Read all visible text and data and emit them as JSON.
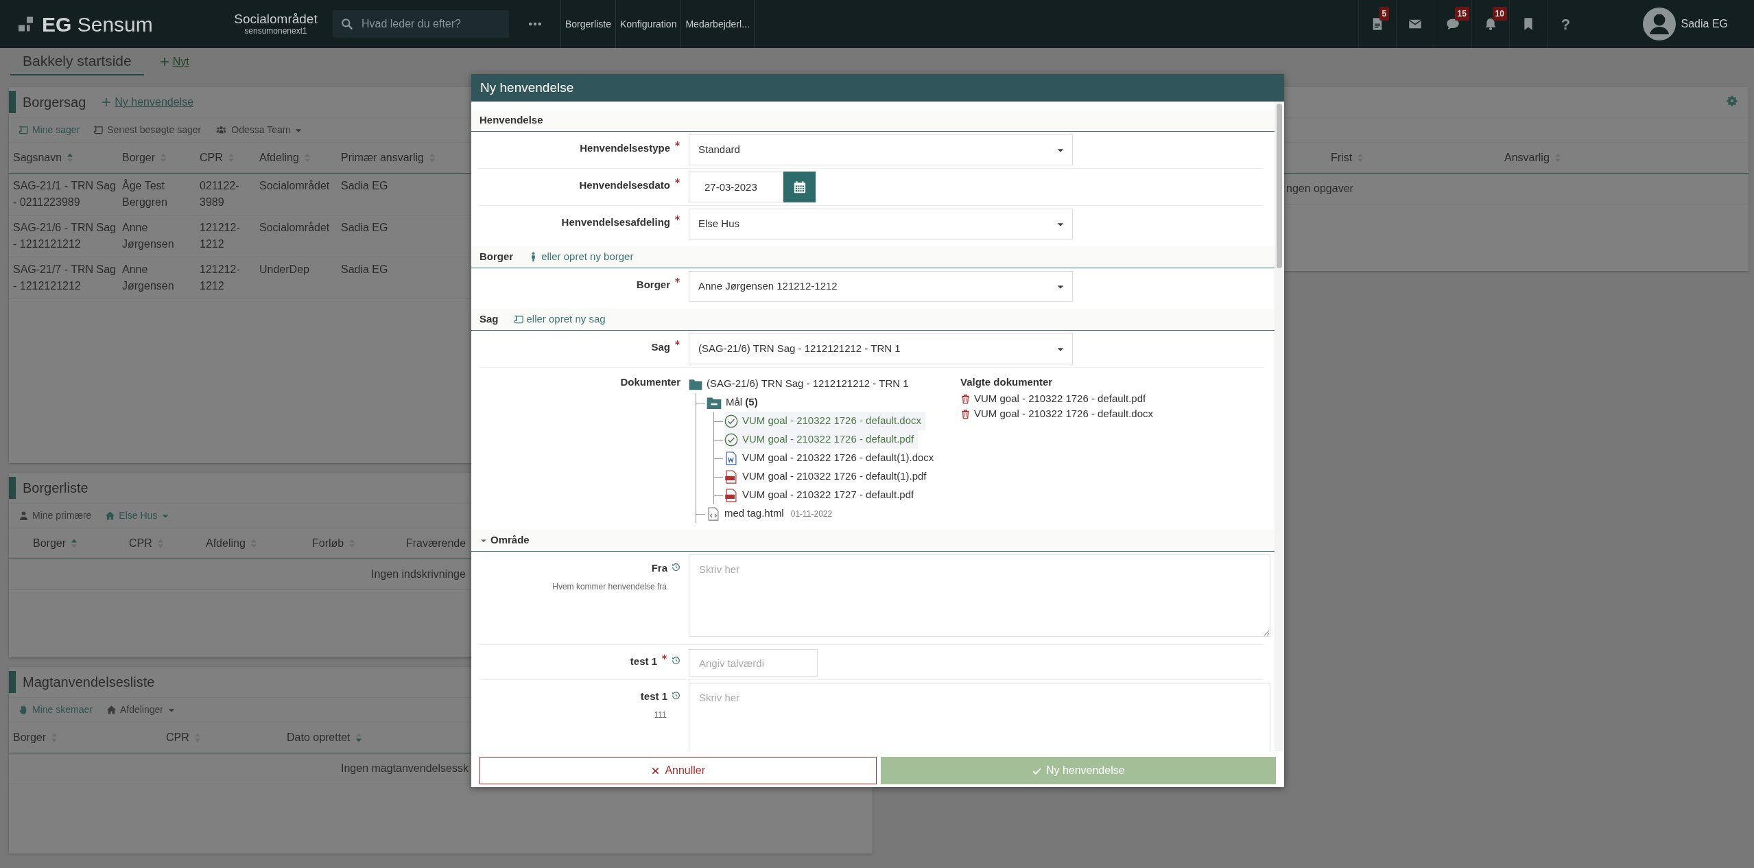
{
  "topbar": {
    "logo": "**EG** Sensum",
    "context_title": "Socialområdet",
    "context_subtitle": "sensumonenext1",
    "search": {
      "placeholder": "Hvad leder du efter?"
    },
    "nav_links": [
      "Borgerliste",
      "Konfiguration",
      "Medarbejderl..."
    ],
    "icons": [
      {
        "kind": "document",
        "badge": "5"
      },
      {
        "kind": "mail"
      },
      {
        "kind": "chat",
        "badge": "15"
      },
      {
        "kind": "bell",
        "badge": "10"
      },
      {
        "kind": "bookmark"
      },
      {
        "kind": "help",
        "glyph": "?"
      }
    ],
    "user": "Sadia EG"
  },
  "page_tabs": [
    {
      "label": "Bakkely startside",
      "selected": true
    }
  ],
  "new_tab": "Nyt",
  "panels": [
    {
      "title": "Borgersag",
      "action": "Ny henvendelse",
      "filters": [
        {
          "label": "Mine sager",
          "selected": true
        },
        {
          "label": "Senest besøgte sager",
          "selected": false
        },
        {
          "label": "Odessa Team",
          "selected": false,
          "dropdown": true
        }
      ],
      "columns": [
        {
          "label": "Sagsnavn",
          "sorted": true,
          "descending": false
        },
        {
          "label": "Borger",
          "sorted": false
        },
        {
          "label": "CPR",
          "sorted": false
        },
        {
          "label": "Afdeling",
          "sorted": false
        },
        {
          "label": "Primær ansvarlig",
          "sorted": false
        }
      ],
      "rows": [
        [
          "SAG-21/1 - TRN Sag - 0211223989",
          "Åge Test Berggren",
          "021122-3989",
          "Socialområdet",
          "Sadia EG"
        ],
        [
          "SAG-21/6 - TRN Sag - 1212121212",
          "Anne Jørgensen",
          "121212-1212",
          "Socialområdet",
          "Sadia EG"
        ],
        [
          "SAG-21/7 - TRN Sag - 1212121212",
          "Anne Jørgensen",
          "121212-1212",
          "UnderDep",
          "Sadia EG"
        ]
      ]
    },
    {
      "title": "Borgerliste",
      "filters": [
        {
          "label": "Mine primære",
          "selected": false
        },
        {
          "label": "Else Hus",
          "selected": true,
          "dropdown": true
        }
      ],
      "columns": [
        {
          "label": "Borger",
          "sorted": true,
          "descending": false
        },
        {
          "label": "CPR",
          "sorted": false
        },
        {
          "label": "Afdeling",
          "sorted": false
        },
        {
          "label": "Forløb",
          "sorted": false
        },
        {
          "label": "Fraværende"
        }
      ],
      "empty_text": "Ingen indskrivninge"
    },
    {
      "title": "Magtanvendelsesliste",
      "filters": [
        {
          "label": "Mine skemaer",
          "selected": true
        },
        {
          "label": "Afdelinger",
          "selected": false,
          "dropdown": true
        }
      ],
      "columns": [
        {
          "label": "Borger",
          "sorted": false
        },
        {
          "label": "CPR",
          "sorted": false
        },
        {
          "label": "Dato oprettet",
          "sorted": true,
          "descending": true
        }
      ],
      "empty_text": "Ingen magtanvendelsessk"
    }
  ],
  "side_panel": {
    "columns": [
      {
        "label": "Frist",
        "sorted": false
      },
      {
        "label": "Ansvarlig",
        "sorted": false
      }
    ],
    "empty_text": "ngen opgaver"
  },
  "modal": {
    "title": "Ny henvendelse",
    "sections": [
      {
        "title": "Henvendelse",
        "fields": [
          {
            "label": "Henvendelsestype",
            "required": true,
            "history": false,
            "kind": "select",
            "value": "Standard"
          },
          {
            "label": "Henvendelsesdato",
            "required": true,
            "history": false,
            "kind": "date",
            "value": "27-03-2023"
          },
          {
            "label": "Henvendelsesafdeling",
            "required": true,
            "history": false,
            "kind": "select",
            "value": "Else Hus"
          }
        ]
      },
      {
        "title": "Borger",
        "link": {
          "label": "eller opret ny borger",
          "kind": "person"
        },
        "fields": [
          {
            "label": "Borger",
            "required": true,
            "history": false,
            "kind": "select",
            "value": "Anne Jørgensen 121212-1212"
          }
        ]
      },
      {
        "title": "Sag",
        "link": {
          "label": "eller opret ny sag",
          "kind": "case"
        },
        "fields": [
          {
            "label": "Sag",
            "required": true,
            "history": false,
            "kind": "select",
            "value": "(SAG-21/6) TRN Sag - 1212121212 - TRN 1"
          },
          {
            "label": "Dokumenter",
            "required": false,
            "history": false,
            "kind": "documents",
            "tree": [
              {
                "label": "(SAG-21/6) TRN Sag - 1212121212 - TRN 1",
                "kind": "folder",
                "children": [
                  {
                    "label": "Mål",
                    "count": "(5)",
                    "kind": "group",
                    "expanded": true,
                    "children": [
                      {
                        "label": "VUM goal - 210322 1726 - default.docx",
                        "kind": "docx",
                        "selected": true
                      },
                      {
                        "label": "VUM goal - 210322 1726 - default.pdf",
                        "kind": "pdf",
                        "selected": true
                      },
                      {
                        "label": "VUM goal - 210322 1726 - default(1).docx",
                        "kind": "docx",
                        "selected": false
                      },
                      {
                        "label": "VUM goal - 210322 1726 - default(1).pdf",
                        "kind": "pdf",
                        "selected": false
                      },
                      {
                        "label": "VUM goal - 210322 1727 - default.pdf",
                        "kind": "pdf",
                        "selected": false
                      }
                    ]
                  },
                  {
                    "label": "med tag.html",
                    "date": "01-11-2022",
                    "kind": "html"
                  }
                ]
              }
            ],
            "selected_title": "Valgte dokumenter",
            "selected_docs": [
              "VUM goal - 210322 1726 - default.pdf",
              "VUM goal - 210322 1726 - default.docx"
            ]
          }
        ]
      },
      {
        "title": "Område",
        "expanded": true,
        "fields": [
          {
            "label": "Fra",
            "required": false,
            "history": true,
            "hint": "Hvem kommer henvendelse fra",
            "kind": "textarea",
            "placeholder": "Skriv her"
          },
          {
            "label": "test 1",
            "required": true,
            "history": true,
            "kind": "number",
            "placeholder": "Angiv talværdi"
          },
          {
            "label": "test 1",
            "required": false,
            "history": true,
            "hint": "111",
            "kind": "textarea",
            "placeholder": "Skriv her"
          }
        ]
      }
    ],
    "buttons": [
      {
        "label": "Annuller",
        "kind": "cancel"
      },
      {
        "label": "Ny henvendelse",
        "kind": "submit",
        "disabled": true
      }
    ]
  }
}
